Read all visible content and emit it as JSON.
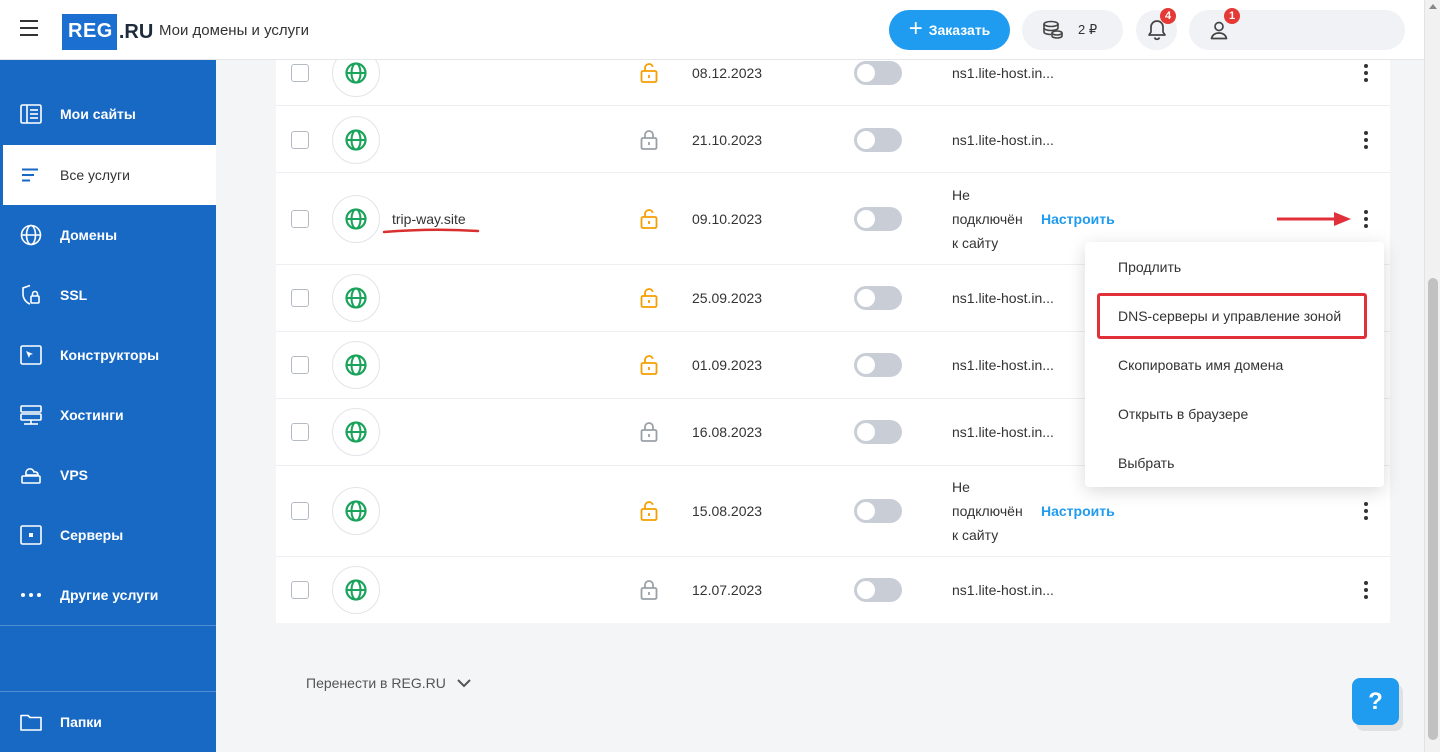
{
  "header": {
    "title": "Мои домены и услуги",
    "logo_main": "REG",
    "logo_suffix": ".RU",
    "order_label": "Заказать",
    "balance": "2 ₽",
    "notifications_count": "4",
    "user_count": "1"
  },
  "sidebar": {
    "items": [
      {
        "label": "Мои сайты",
        "icon": "sites-icon"
      },
      {
        "label": "Все услуги",
        "icon": "list-icon",
        "active": true
      },
      {
        "label": "Домены",
        "icon": "globe-icon"
      },
      {
        "label": "SSL",
        "icon": "shield-lock-icon"
      },
      {
        "label": "Конструкторы",
        "icon": "builder-icon"
      },
      {
        "label": "Хостинги",
        "icon": "hosting-icon"
      },
      {
        "label": "VPS",
        "icon": "vps-cloud-icon"
      },
      {
        "label": "Серверы",
        "icon": "server-icon"
      },
      {
        "label": "Другие услуги",
        "icon": "dots-icon"
      }
    ],
    "folders_label": "Папки"
  },
  "rows": [
    {
      "domain": "",
      "lock": "open",
      "date": "08.12.2023",
      "ns": "ns1.lite-host.in..."
    },
    {
      "domain": "",
      "lock": "closed",
      "date": "21.10.2023",
      "ns": "ns1.lite-host.in..."
    },
    {
      "domain": "trip-way.site",
      "lock": "open",
      "date": "09.10.2023",
      "ns_lines": [
        "Не",
        "подключён",
        "к сайту"
      ],
      "setup": "Настроить"
    },
    {
      "domain": "",
      "lock": "open",
      "date": "25.09.2023",
      "ns": "ns1.lite-host.in..."
    },
    {
      "domain": "",
      "lock": "open",
      "date": "01.09.2023",
      "ns": "ns1.lite-host.in..."
    },
    {
      "domain": "",
      "lock": "closed",
      "date": "16.08.2023",
      "ns": "ns1.lite-host.in..."
    },
    {
      "domain": "",
      "lock": "open",
      "date": "15.08.2023",
      "ns_lines": [
        "Не",
        "подключён",
        "к сайту"
      ],
      "setup": "Настроить"
    },
    {
      "domain": "",
      "lock": "closed",
      "date": "12.07.2023",
      "ns": "ns1.lite-host.in..."
    }
  ],
  "menu": {
    "items": [
      "Продлить",
      "DNS-серверы и управление зоной",
      "Скопировать имя домена",
      "Открыть в браузере",
      "Выбрать"
    ]
  },
  "transfer_label": "Перенести в REG.RU",
  "help_label": "?",
  "colors": {
    "accent": "#1f9bef",
    "sidebar": "#1869c4",
    "lock_open": "#f59f00",
    "lock_closed": "#9aa0a8",
    "globe": "#1aa35a",
    "highlight": "#e0303a"
  }
}
